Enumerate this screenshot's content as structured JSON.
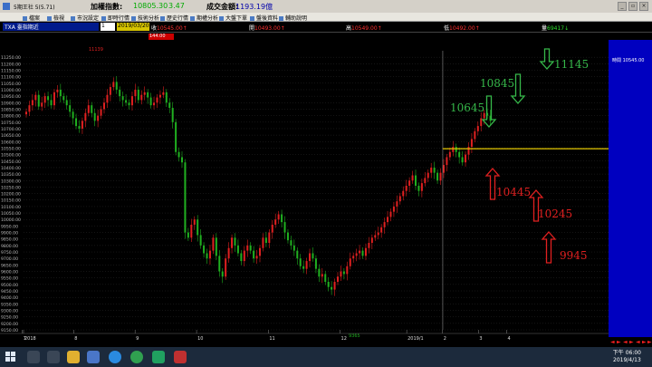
{
  "window": {
    "title": "5期王社 5(5.71)",
    "index_label": "加權指數:",
    "index_value": "10805.30",
    "index_change": "3.47",
    "turnover_label": "成交金額:",
    "turnover_value": "1193.19億"
  },
  "menu": [
    {
      "label": "檔案"
    },
    {
      "label": "檢視"
    },
    {
      "label": "市況設定"
    },
    {
      "label": "即時行情"
    },
    {
      "label": "技術分析"
    },
    {
      "label": "歷史行情"
    },
    {
      "label": "期權分析"
    },
    {
      "label": "大盤下單"
    },
    {
      "label": "盤後資料"
    },
    {
      "label": "輔助說明"
    }
  ],
  "quote_bar": {
    "symbol": "TXA 臺指期近",
    "period": "1",
    "date": "2019/03/20",
    "close_label": "收",
    "close_value": "10545.00↑",
    "open_label": "開",
    "open_value": "10493.00↑",
    "high_label": "高",
    "high_value": "10549.00↑",
    "low_label": "低",
    "low_value": "10492.00↑",
    "vol_label": "量",
    "vol_value": "69417↓"
  },
  "price_tag": "144.00",
  "colors": {
    "up": "#e02020",
    "down": "#20b020",
    "grid": "#2a2a2a",
    "level_line": "#e6c800",
    "annotation_green": "#36b84a",
    "annotation_red": "#e02020",
    "panel_blue": "#0000c0"
  },
  "chart_data": {
    "type": "candlestick",
    "yaxis": {
      "min": 9150,
      "max": 11300,
      "ticks": [
        11250,
        11200,
        11150,
        11100,
        11050,
        11000,
        10950,
        10900,
        10850,
        10800,
        10750,
        10700,
        10650,
        10600,
        10550,
        10500,
        10450,
        10400,
        10350,
        10300,
        10250,
        10200,
        10150,
        10100,
        10050,
        10000,
        9950,
        9900,
        9850,
        9800,
        9750,
        9700,
        9650,
        9600,
        9550,
        9500,
        9450,
        9400,
        9350,
        9300,
        9250,
        9200,
        9150
      ]
    },
    "xaxis_labels": [
      "2018",
      "7",
      "8",
      "9",
      "10",
      "11",
      "12",
      "2019/1",
      "2",
      "3",
      "4"
    ],
    "top_marker": "11139",
    "bottom_marker": "9365",
    "level_line": 10545,
    "level_label": "10545",
    "annotations": [
      {
        "text": "10645",
        "color": "green",
        "direction": "down"
      },
      {
        "text": "10845",
        "color": "green",
        "direction": "down"
      },
      {
        "text": "11145",
        "color": "green",
        "direction": "down"
      },
      {
        "text": "10445",
        "color": "red",
        "direction": "up"
      },
      {
        "text": "10245",
        "color": "red",
        "direction": "up"
      },
      {
        "text": "9945",
        "color": "red",
        "direction": "up"
      }
    ],
    "right_panel_label": "時間 10545.00",
    "series_closes": [
      10830,
      10880,
      10920,
      10960,
      10870,
      10900,
      10950,
      10920,
      10880,
      10980,
      11000,
      10950,
      10920,
      10880,
      10830,
      10780,
      10720,
      10700,
      10760,
      10820,
      10880,
      10820,
      10760,
      10800,
      10850,
      10900,
      10960,
      11020,
      11060,
      11000,
      10950,
      10920,
      10900,
      10880,
      10950,
      11000,
      10920,
      10960,
      10980,
      10940,
      10880,
      10900,
      10940,
      10960,
      10980,
      10900,
      10860,
      10750,
      10520,
      10480,
      10440,
      9900,
      9860,
      9960,
      10000,
      9880,
      9800,
      9740,
      9700,
      9760,
      9860,
      9720,
      9600,
      9560,
      9700,
      9780,
      9860,
      9800,
      9740,
      9680,
      9760,
      9800,
      9760,
      9700,
      9720,
      9780,
      9860,
      9820,
      9900,
      9960,
      10000,
      10040,
      9980,
      9900,
      9840,
      9800,
      9760,
      9700,
      9640,
      9620,
      9680,
      9740,
      9700,
      9620,
      9560,
      9580,
      9520,
      9480,
      9460,
      9520,
      9560,
      9600,
      9580,
      9640,
      9700,
      9720,
      9740,
      9760,
      9720,
      9780,
      9820,
      9860,
      9880,
      9900,
      9940,
      9980,
      10020,
      10060,
      10100,
      10140,
      10180,
      10220,
      10260,
      10300,
      10340,
      10260,
      10220,
      10280,
      10320,
      10360,
      10400,
      10360,
      10300,
      10360,
      10420,
      10480,
      10520,
      10560,
      10520,
      10480,
      10440,
      10500,
      10560,
      10620,
      10680,
      10720,
      10780,
      10820,
      10800,
      10760
    ]
  },
  "taskbar": {
    "time": "下午 06:00",
    "date": "2019/4/13"
  },
  "scroll_arrows": [
    "◄",
    "►",
    "◄",
    "►",
    "◄",
    "►",
    "►"
  ]
}
